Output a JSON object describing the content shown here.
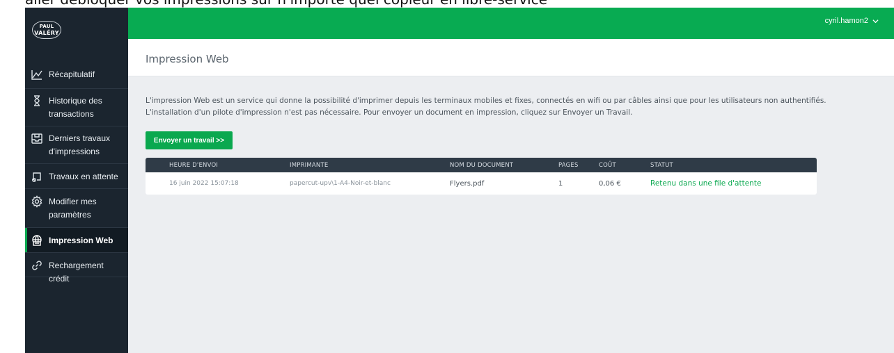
{
  "caption": "aller débloquer vos impressions sur n'importe quel copieur en libre-service",
  "logo": {
    "line1": "PAUL",
    "line2": "VALÉRY"
  },
  "user": {
    "name": "cyril.hamon2"
  },
  "sidebar": {
    "items": [
      {
        "label": "Récapitulatif",
        "icon": "chart-line-icon"
      },
      {
        "label": "Historique des transactions",
        "icon": "hourglass-icon"
      },
      {
        "label": "Derniers travaux d'impressions",
        "icon": "tray-icon"
      },
      {
        "label": "Travaux en attente",
        "icon": "pending-jobs-icon"
      },
      {
        "label": "Modifier mes paramètres",
        "icon": "gear-icon"
      },
      {
        "label": "Impression Web",
        "icon": "web-print-icon",
        "active": true
      },
      {
        "label": "Rechargement crédit",
        "icon": "link-icon"
      }
    ]
  },
  "page": {
    "title": "Impression Web",
    "description_line1": "L'impression Web est un service qui donne la possibilité d'imprimer depuis les terminaux mobiles et fixes, connectés en wifi ou par câbles ainsi que pour les utilisateurs non authentifiés.",
    "description_line2": "L'installation d'un pilote d'impression n'est pas nécessaire. Pour envoyer un document en impression, cliquez sur Envoyer un Travail.",
    "send_button": "Envoyer un travail >>"
  },
  "table": {
    "headers": [
      "HEURE D'ENVOI",
      "IMPRIMANTE",
      "NOM DU DOCUMENT",
      "PAGES",
      "COÛT",
      "STATUT"
    ],
    "rows": [
      [
        "16 juin 2022 15:07:18",
        "papercut-upv\\1-A4-Noir-et-blanc",
        "Flyers.pdf",
        "1",
        "0,06 €",
        "Retenu dans une file d'attente"
      ]
    ]
  },
  "colors": {
    "accent": "#0aa84f",
    "sidebar": "#1b252f",
    "header_row": "#2f3b47"
  }
}
